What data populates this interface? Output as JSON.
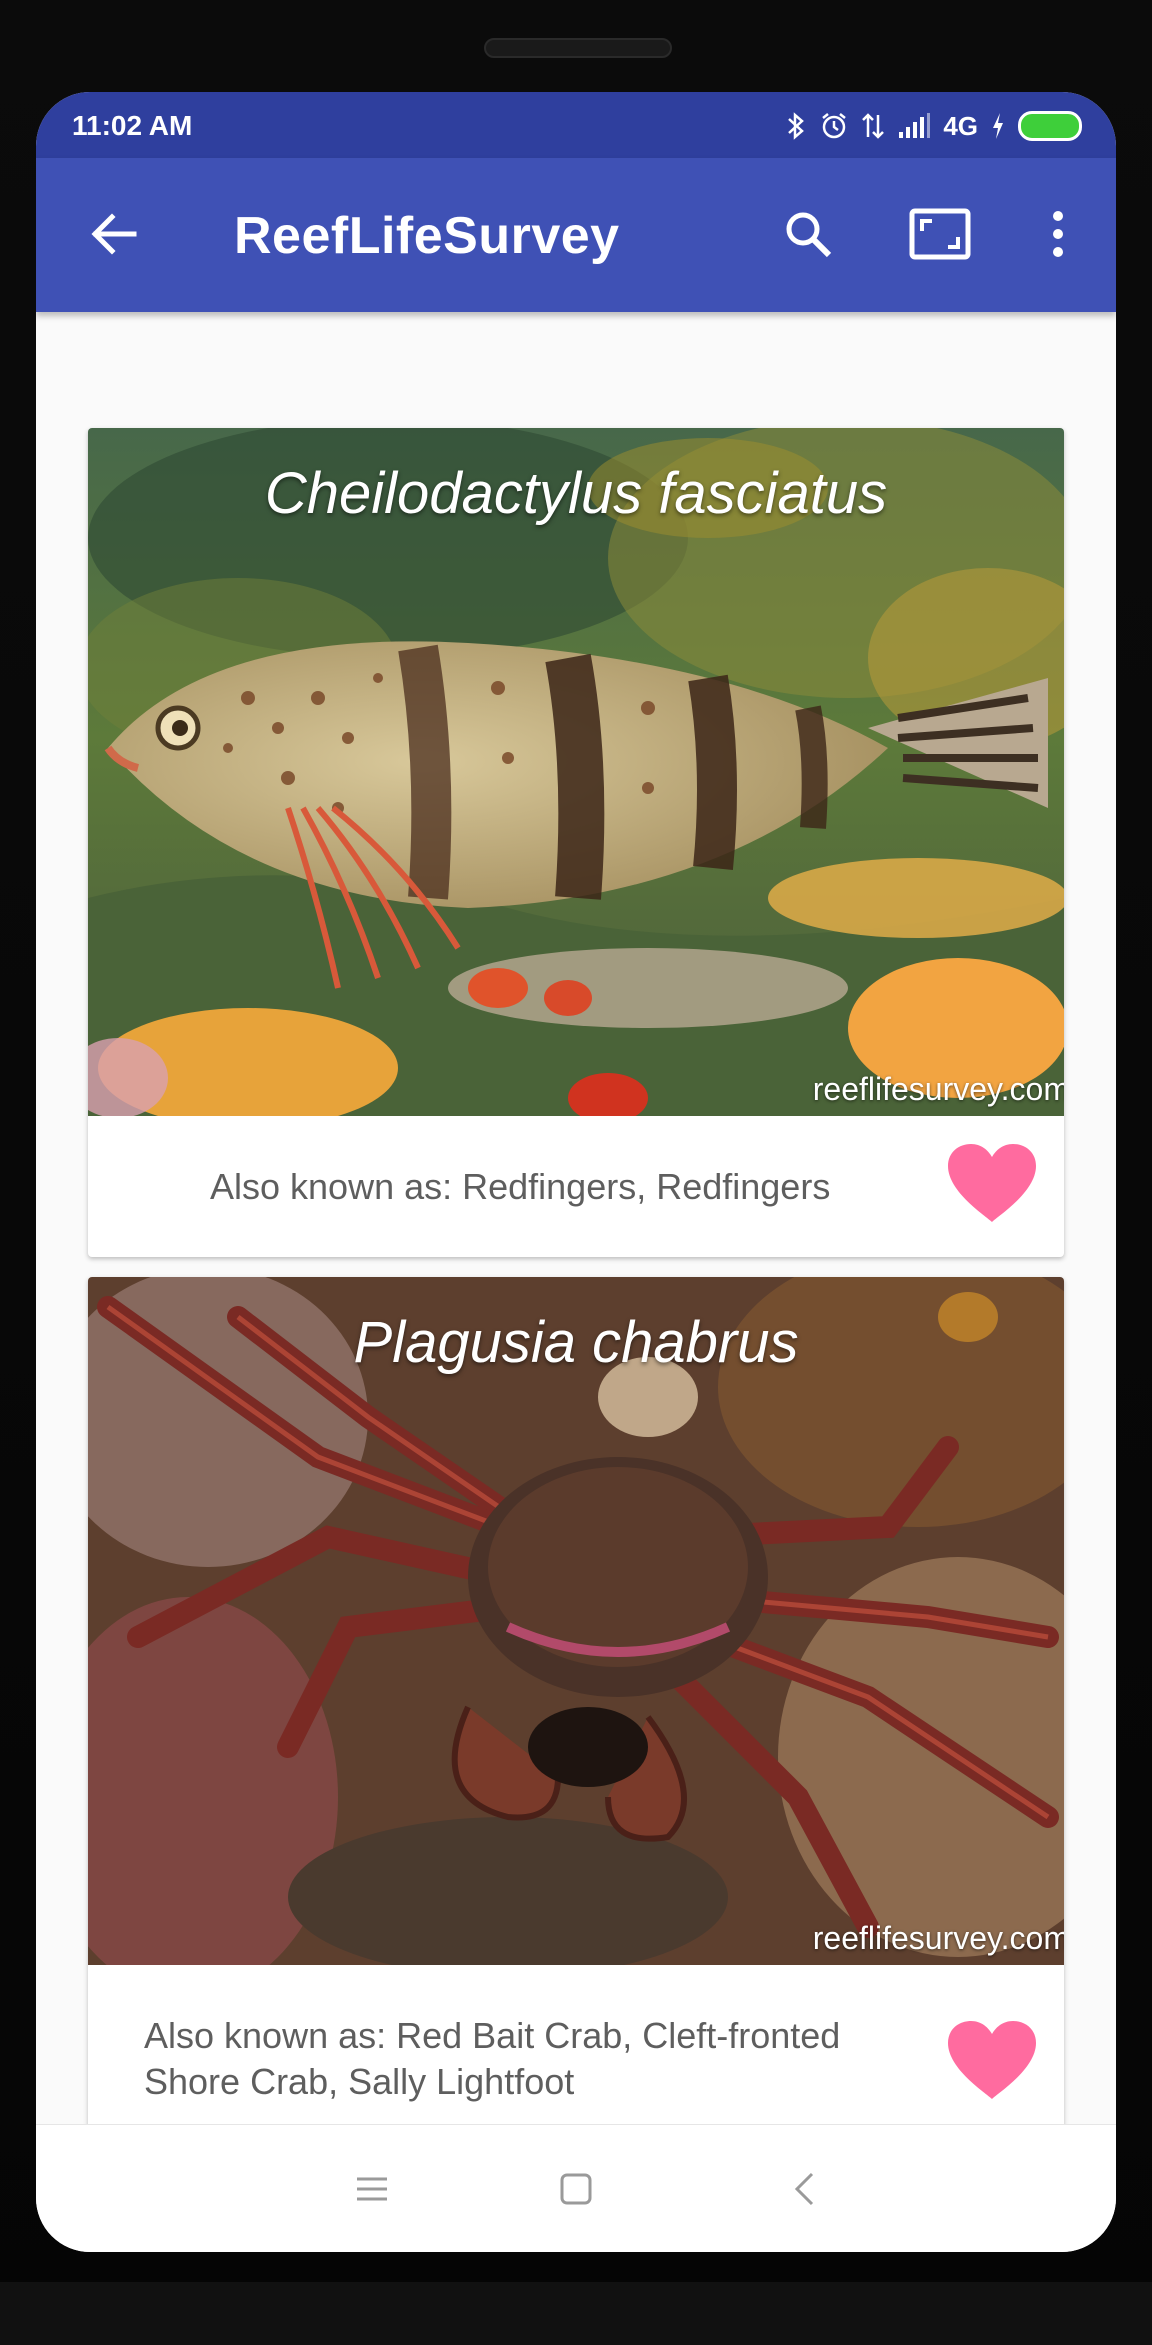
{
  "status_bar": {
    "time": "11:02 AM",
    "network": "4G",
    "icons": [
      "bluetooth-icon",
      "alarm-icon",
      "data-arrows-icon",
      "signal-icon",
      "charging-icon",
      "battery-icon"
    ]
  },
  "app_bar": {
    "title": "ReefLifeSurvey",
    "icons": [
      "back-arrow-icon",
      "search-icon",
      "fullscreen-icon",
      "more-vert-icon"
    ]
  },
  "cards": [
    {
      "scientific_name": "Cheilodactylus fasciatus",
      "watermark": "reeflifesurvey.com",
      "also_known_as": "Also known as: Redfingers, Redfingers",
      "favorited": true
    },
    {
      "scientific_name": "Plagusia chabrus",
      "watermark": "reeflifesurvey.com",
      "also_known_as": "Also known as: Red Bait Crab, Cleft-fronted Shore Crab, Sally Lightfoot",
      "favorited": true
    }
  ],
  "colors": {
    "primary": "#3f51b5",
    "status_bar": "#2f3f9e",
    "heart": "#ff6b9f",
    "battery": "#3ecf3a"
  },
  "nav_bar": {
    "icons": [
      "menu-icon",
      "home-icon",
      "back-icon"
    ]
  }
}
